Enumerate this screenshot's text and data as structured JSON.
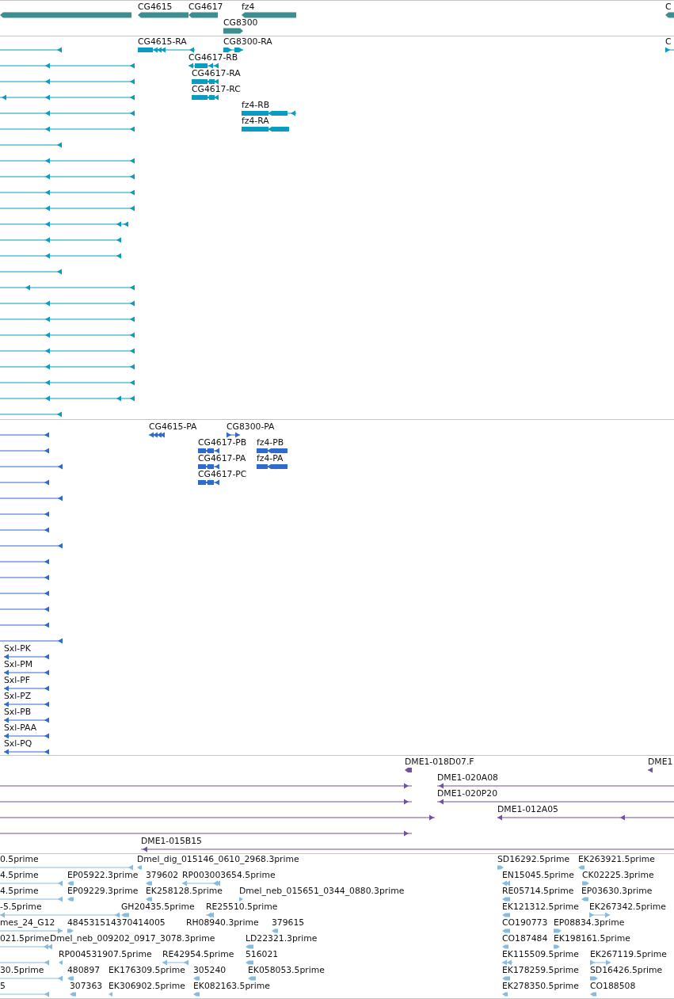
{
  "tracks": [
    {
      "kind": "gene",
      "features": [
        {
          "reverse": true
        },
        {
          "label": "CG4615",
          "reverse": true
        },
        {
          "label": "CG4617",
          "reverse": true
        },
        {
          "label": "fz4",
          "reverse": true
        },
        {
          "label": "C",
          "reverse": true
        },
        {
          "label": "CG8300",
          "reverse": false
        }
      ]
    },
    {
      "kind": "transcript",
      "features": [
        {
          "reverse": true
        },
        {
          "label": "CG4615-RA",
          "reverse": true
        },
        {
          "label": "CG8300-RA",
          "reverse": false
        },
        {
          "label": "C",
          "reverse": false
        },
        {
          "reverse": true
        },
        {
          "label": "CG4617-RB",
          "reverse": true
        },
        {
          "reverse": true
        },
        {
          "label": "CG4617-RA",
          "reverse": true
        },
        {
          "reverse": true
        },
        {
          "label": "CG4617-RC",
          "reverse": true
        },
        {
          "reverse": true
        },
        {
          "label": "fz4-RB",
          "reverse": true
        },
        {
          "reverse": true
        },
        {
          "label": "fz4-RA",
          "reverse": true
        },
        {
          "reverse": true
        },
        {
          "reverse": true
        },
        {
          "reverse": true
        },
        {
          "reverse": true
        },
        {
          "reverse": true
        },
        {
          "reverse": true
        },
        {
          "reverse": true
        },
        {
          "reverse": true
        },
        {
          "reverse": true
        },
        {
          "reverse": true
        },
        {
          "reverse": true
        },
        {
          "reverse": true
        },
        {
          "reverse": true
        },
        {
          "reverse": true
        },
        {
          "reverse": true
        },
        {
          "reverse": true
        },
        {
          "reverse": true
        },
        {
          "reverse": true
        }
      ]
    },
    {
      "kind": "protein",
      "features": [
        {
          "reverse": true
        },
        {
          "label": "CG4615-PA",
          "reverse": true
        },
        {
          "label": "CG8300-PA",
          "reverse": false
        },
        {
          "reverse": true
        },
        {
          "label": "CG4617-PB",
          "reverse": true
        },
        {
          "label": "fz4-PB",
          "reverse": true
        },
        {
          "reverse": true
        },
        {
          "label": "CG4617-PA",
          "reverse": true
        },
        {
          "label": "fz4-PA",
          "reverse": true
        },
        {
          "reverse": true
        },
        {
          "label": "CG4617-PC",
          "reverse": true
        },
        {
          "reverse": true
        },
        {
          "reverse": true
        },
        {
          "reverse": true
        },
        {
          "reverse": true
        },
        {
          "reverse": true
        },
        {
          "reverse": true
        },
        {
          "reverse": true
        },
        {
          "reverse": true
        },
        {
          "reverse": true
        },
        {
          "reverse": true
        },
        {
          "label": "Sxl-PK",
          "reverse": true
        },
        {
          "label": "Sxl-PM",
          "reverse": true
        },
        {
          "label": "Sxl-PF",
          "reverse": true
        },
        {
          "label": "Sxl-PZ",
          "reverse": true
        },
        {
          "label": "Sxl-PB",
          "reverse": true
        },
        {
          "label": "Sxl-PAA",
          "reverse": true
        },
        {
          "label": "Sxl-PQ",
          "reverse": true
        }
      ]
    },
    {
      "kind": "clone",
      "features": [
        {
          "label": "DME1-018D07.F",
          "reverse": true
        },
        {
          "label": "DME1",
          "reverse": true
        },
        {
          "reverse": false
        },
        {
          "label": "DME1-020A08",
          "reverse": true
        },
        {
          "reverse": false
        },
        {
          "label": "DME1-020P20",
          "reverse": true
        },
        {
          "reverse": false
        },
        {
          "label": "DME1-012A05",
          "reverse": true
        },
        {
          "reverse": false
        },
        {
          "label": "DME1-015B15",
          "reverse": true
        }
      ]
    },
    {
      "kind": "est",
      "features": [
        {
          "label": "0.5prime",
          "reverse": true
        },
        {
          "label": "Dmel_dig_015146_0610_2968.3prime",
          "reverse": true
        },
        {
          "label": "SD16292.5prime",
          "reverse": false
        },
        {
          "label": "EK263921.5prime",
          "reverse": true
        },
        {
          "label": "4.5prime",
          "reverse": true
        },
        {
          "label": "EP05922.3prime",
          "reverse": true
        },
        {
          "label": "379602",
          "reverse": true
        },
        {
          "label": "RP003003654.5prime",
          "reverse": true
        },
        {
          "label": "EN15045.5prime",
          "reverse": true
        },
        {
          "label": "CK02225.3prime",
          "reverse": false
        },
        {
          "label": "4.5prime",
          "reverse": true
        },
        {
          "label": "EP09229.3prime",
          "reverse": true
        },
        {
          "label": "EK258128.5prime",
          "reverse": true
        },
        {
          "label": "Dmel_neb_015651_0344_0880.3prime",
          "reverse": false
        },
        {
          "label": "RE05714.5prime",
          "reverse": true
        },
        {
          "label": "EP03630.3prime",
          "reverse": true
        },
        {
          "label": "-5.5prime",
          "reverse": true
        },
        {
          "label": "GH20435.5prime",
          "reverse": true
        },
        {
          "label": "RE25510.5prime",
          "reverse": true
        },
        {
          "label": "EK121312.5prime",
          "reverse": true
        },
        {
          "label": "EK267342.5prime",
          "reverse": false
        },
        {
          "label": "mes_24_G12",
          "reverse": false
        },
        {
          "label": "484531514370414005",
          "reverse": false
        },
        {
          "label": "RH08940.3prime"
        },
        {
          "label": "379615",
          "reverse": true
        },
        {
          "label": "CO190773",
          "reverse": true
        },
        {
          "label": "EP08834.3prime",
          "reverse": false
        },
        {
          "label": "021.5prime",
          "reverse": true
        },
        {
          "label": "Dmel_neb_009202_0917_3078.3prime"
        },
        {
          "label": "LD22321.3prime",
          "reverse": true
        },
        {
          "label": "CO187484",
          "reverse": true
        },
        {
          "label": "EK198161.5prime",
          "reverse": false
        },
        {
          "reverse": true
        },
        {
          "label": "RP004531907.5prime",
          "reverse": true
        },
        {
          "label": "RE42954.5prime",
          "reverse": true
        },
        {
          "label": "516021",
          "reverse": true
        },
        {
          "label": "EK115509.5prime",
          "reverse": true
        },
        {
          "label": "EK267119.5prime",
          "reverse": false
        },
        {
          "label": "30.5prime",
          "reverse": true
        },
        {
          "label": "480897",
          "reverse": true
        },
        {
          "label": "EK176309.5prime"
        },
        {
          "label": "305240",
          "reverse": true
        },
        {
          "label": "EK058053.5prime",
          "reverse": true
        },
        {
          "label": "EK178259.5prime",
          "reverse": true
        },
        {
          "label": "SD16426.5prime",
          "reverse": false
        },
        {
          "label": "5",
          "reverse": true
        },
        {
          "label": "307363",
          "reverse": true
        },
        {
          "label": "EK306902.5prime",
          "reverse": true
        },
        {
          "label": "EK082163.5prime",
          "reverse": true
        },
        {
          "label": "EK278350.5prime",
          "reverse": true
        },
        {
          "label": "CO188508",
          "reverse": true
        }
      ]
    }
  ]
}
